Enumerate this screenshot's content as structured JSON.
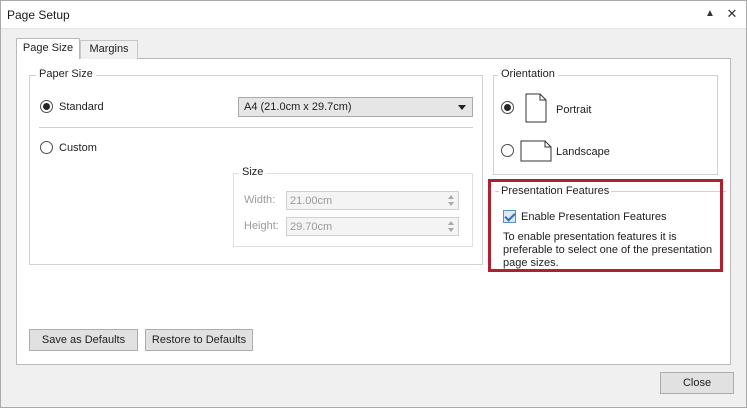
{
  "window": {
    "title": "Page Setup"
  },
  "tabs": [
    {
      "label": "Page Size",
      "active": true
    },
    {
      "label": "Margins",
      "active": false
    }
  ],
  "paper_size": {
    "legend": "Paper Size",
    "standard_label": "Standard",
    "standard_selected": true,
    "standard_value": "A4 (21.0cm x 29.7cm)",
    "custom_label": "Custom",
    "custom_selected": false,
    "size_group": {
      "legend": "Size",
      "width_label": "Width:",
      "width_value": "21.00cm",
      "height_label": "Height:",
      "height_value": "29.70cm"
    }
  },
  "orientation": {
    "legend": "Orientation",
    "portrait_label": "Portrait",
    "portrait_selected": true,
    "landscape_label": "Landscape",
    "landscape_selected": false,
    "icons": [
      "portrait-page-icon",
      "landscape-page-icon"
    ]
  },
  "presentation": {
    "legend": "Presentation Features",
    "checkbox_label": "Enable Presentation Features",
    "checked": true,
    "note": "To enable presentation features it is preferable to select one of the presentation page sizes.",
    "highlight_color": "#b0202e"
  },
  "buttons": {
    "save_defaults": "Save as Defaults",
    "restore_defaults": "Restore to Defaults",
    "close": "Close"
  },
  "titlebar_icons": [
    "collapse-up-icon",
    "close-icon"
  ]
}
